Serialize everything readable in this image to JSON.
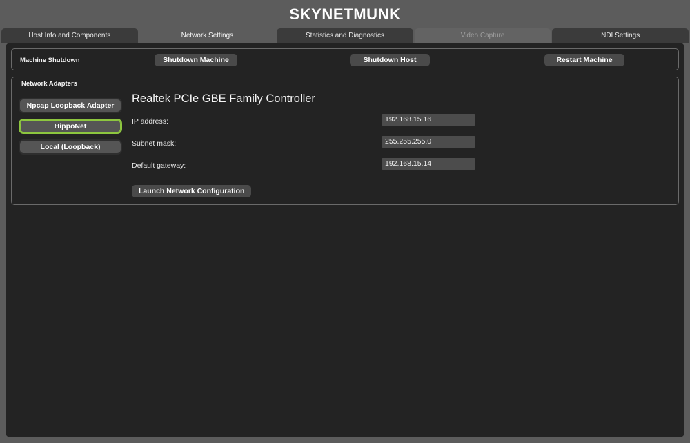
{
  "app": {
    "title": "SKYNETMUNK"
  },
  "tabs": [
    {
      "label": "Host Info and Components",
      "state": "inactive"
    },
    {
      "label": "Network Settings",
      "state": "active"
    },
    {
      "label": "Statistics and Diagnostics",
      "state": "inactive"
    },
    {
      "label": "Video Capture",
      "state": "disabled"
    },
    {
      "label": "NDI Settings",
      "state": "inactive"
    }
  ],
  "shutdown_panel": {
    "legend": "Machine Shutdown",
    "buttons": [
      {
        "label": "Shutdown Machine"
      },
      {
        "label": "Shutdown Host"
      },
      {
        "label": "Restart Machine"
      }
    ]
  },
  "adapters_panel": {
    "legend": "Network Adapters",
    "adapters": [
      {
        "label": "Npcap Loopback Adapter",
        "selected": false
      },
      {
        "label": "HippoNet",
        "selected": true
      },
      {
        "label": "Local (Loopback)",
        "selected": false
      }
    ],
    "selected_adapter": {
      "name": "Realtek PCIe GBE Family Controller",
      "fields": [
        {
          "label": "IP address:",
          "value": "192.168.15.16"
        },
        {
          "label": "Subnet mask:",
          "value": "255.255.255.0"
        },
        {
          "label": "Default gateway:",
          "value": "192.168.15.14"
        }
      ],
      "launch_button": "Launch Network Configuration"
    }
  },
  "colors": {
    "frame": "#5c5c5c",
    "content": "#232323",
    "tab_inactive": "#3b3b3b",
    "tab_disabled": "#636363",
    "button": "#4a4a4a",
    "input": "#4c4c4c",
    "accent_green": "#8dc63f",
    "panel_border": "#6a6a6a"
  }
}
